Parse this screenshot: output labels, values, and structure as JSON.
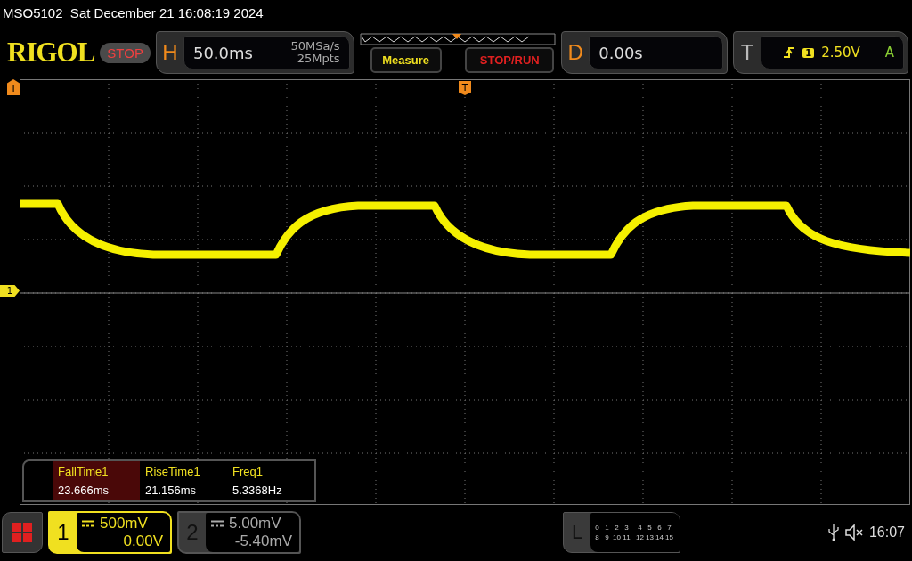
{
  "title_bar": {
    "text": "MSO5102  Sat December 21 16:08:19 2024"
  },
  "top_bar": {
    "logo": "RIGOL",
    "run_state": "STOP",
    "horizontal": {
      "letter": "H",
      "timebase": "50.0ms",
      "sample_rate": "50MSa/s",
      "memory_depth": "25Mpts"
    },
    "measure_button": "Measure",
    "stop_run_button": "STOP/RUN",
    "delay": {
      "letter": "D",
      "value": "0.00s"
    },
    "trigger": {
      "letter": "T",
      "source": "1",
      "level": "2.50V",
      "mode": "A"
    }
  },
  "markers": {
    "pre_trigger": "T",
    "trigger_position": "T",
    "channel_1": "1"
  },
  "measurements": [
    {
      "name": "FallTime1",
      "value": "23.666ms",
      "selected": true
    },
    {
      "name": "RiseTime1",
      "value": "21.156ms",
      "selected": false
    },
    {
      "name": "Freq1",
      "value": "5.3368Hz",
      "selected": false
    }
  ],
  "channels": [
    {
      "number": "1",
      "scale": "500mV",
      "offset": "0.00V",
      "active": true
    },
    {
      "number": "2",
      "scale": "5.00mV",
      "offset": "-5.40mV",
      "active": false
    }
  ],
  "logic": {
    "letter": "L",
    "rows": [
      [
        "0",
        "1",
        "2",
        "3",
        "4",
        "5",
        "6",
        "7"
      ],
      [
        "8",
        "9",
        "10",
        "11",
        "12",
        "13",
        "14",
        "15"
      ]
    ]
  },
  "status": {
    "time": "16:07"
  }
}
